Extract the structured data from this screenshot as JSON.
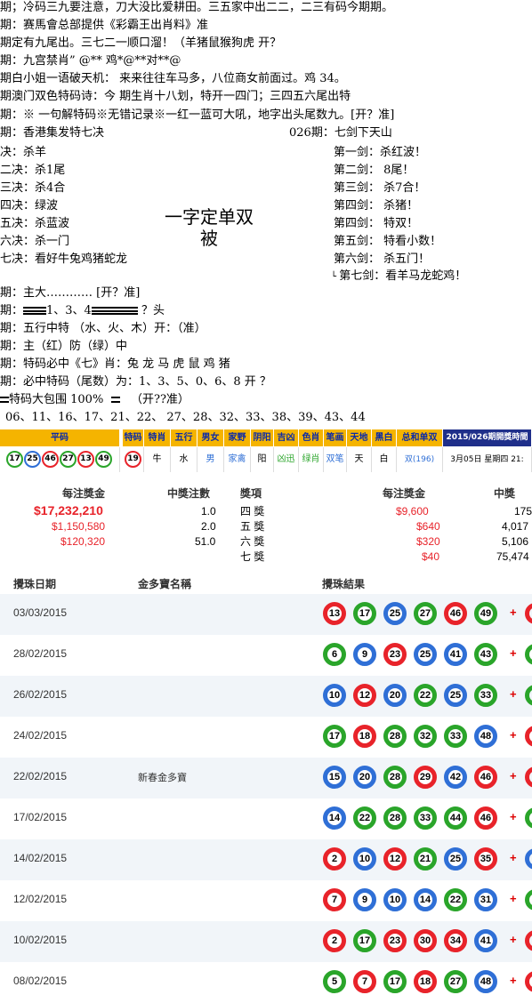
{
  "lines": [
    "期；冷码三九要注意，刀大没比爱耕田。三五家中出二二，二三有码今期期。",
    "期：赛馬會总部提供《彩霸王出肖料》准",
    "期定有九尾出。三七二一顺口溜！（羊猪鼠猴狗虎    开？",
    "期：九宫禁肖”  @** 鸡*@**对**@",
    "期白小姐一语破天机：  来来往往车马多，八位商女前面过。鸡  34。",
    "期澳门双色特码诗：今 期生肖十八划，特开一四门；三四五六尾出特",
    "期：※ 一句解特码※无错记录※一红一蓝可大吼，地字出头尾数九。[开？准]",
    "期：香港集发特七决"
  ],
  "jue_left": [
    "决：杀羊",
    "二决：杀1尾",
    "三决：杀4合",
    "四决：绿波",
    "五决：杀蓝波",
    "六决：杀一门",
    "七决：看好牛兔鸡猪蛇龙"
  ],
  "jue_right_title": "026期：七剑下天山",
  "jue_right": [
    "第一剑：杀红波！",
    "第二剑：  8尾！",
    "第三剑：  杀7合！",
    "第四剑：  杀猪！",
    "第四剑：  特双！",
    "第五剑：  特看小数！",
    "第六剑：  杀五门！",
    "第七剑：看羊马龙蛇鸡！"
  ],
  "big_title_1": "一字定单双",
  "big_title_2": "被",
  "lines2": {
    "zhuda": "期：主大………… [开？准]",
    "tou_mid": "1、3、4",
    "tou_end": "？头",
    "tou_pre": "期：",
    "wuxing": "期：五行中特  （水、火、木）开：（准）",
    "zhufang": "期：主（红）防（绿）中",
    "texiao": "期：特码必中《七》肖：兔 龙 马 虎 鼠 鸡   猪",
    "weishu": "期：必中特码（尾数）为：1、3、5、0、6、8        开 ？",
    "baotou": "特码大包围 100%",
    "baotou_end": "（开??准）",
    "numbers": "06、11、16、17、21、22、 27、28、32、33、38、39、43、44"
  },
  "draw_table": {
    "headers": [
      "平码",
      "特码",
      "特肖",
      "五行",
      "男女",
      "家野",
      "阴阳",
      "吉凶",
      "色肖",
      "笔画",
      "天地",
      "黑白",
      "总和单双",
      "2015/026期開獎時間"
    ],
    "balls": [
      "17",
      "25",
      "46",
      "27",
      "13",
      "49"
    ],
    "special": "19",
    "values": [
      "牛",
      "水",
      "男",
      "家禽",
      "阳",
      "凶迅",
      "绿肖",
      "双笔",
      "天",
      "白",
      "双(196)",
      "3月05日 星期四 21:"
    ]
  },
  "prize": {
    "left_headers": [
      "每注獎金",
      "中獎注數"
    ],
    "left_rows": [
      [
        "$17,232,210",
        "1.0"
      ],
      [
        "$1,150,580",
        "2.0"
      ],
      [
        "$120,320",
        "51.0"
      ]
    ],
    "right_headers": [
      "獎項",
      "每注獎金",
      "中獎"
    ],
    "right_rows": [
      [
        "四 獎",
        "$9,600",
        "175"
      ],
      [
        "五 獎",
        "$640",
        "4,017"
      ],
      [
        "六 獎",
        "$320",
        "5,106"
      ],
      [
        "七 獎",
        "$40",
        "75,474"
      ]
    ]
  },
  "results": {
    "headers": [
      "攪珠日期",
      "金多寶名稱",
      "攪珠結果"
    ],
    "plus": "+",
    "rows": [
      {
        "date": "03/03/2015",
        "name": "",
        "balls": [
          "13",
          "17",
          "25",
          "27",
          "46",
          "49"
        ]
      },
      {
        "date": "28/02/2015",
        "name": "",
        "balls": [
          "6",
          "9",
          "23",
          "25",
          "41",
          "43"
        ]
      },
      {
        "date": "26/02/2015",
        "name": "",
        "balls": [
          "10",
          "12",
          "20",
          "22",
          "25",
          "33"
        ]
      },
      {
        "date": "24/02/2015",
        "name": "",
        "balls": [
          "17",
          "18",
          "28",
          "32",
          "33",
          "48"
        ]
      },
      {
        "date": "22/02/2015",
        "name": "新春金多寶",
        "balls": [
          "15",
          "20",
          "28",
          "29",
          "42",
          "46"
        ]
      },
      {
        "date": "17/02/2015",
        "name": "",
        "balls": [
          "14",
          "22",
          "28",
          "33",
          "44",
          "46"
        ]
      },
      {
        "date": "14/02/2015",
        "name": "",
        "balls": [
          "2",
          "10",
          "12",
          "21",
          "25",
          "35"
        ]
      },
      {
        "date": "12/02/2015",
        "name": "",
        "balls": [
          "7",
          "9",
          "10",
          "14",
          "22",
          "31"
        ]
      },
      {
        "date": "10/02/2015",
        "name": "",
        "balls": [
          "2",
          "17",
          "23",
          "30",
          "34",
          "41"
        ]
      },
      {
        "date": "08/02/2015",
        "name": "",
        "balls": [
          "5",
          "7",
          "17",
          "18",
          "27",
          "48"
        ]
      }
    ]
  },
  "colors": {
    "red": "#e8232a",
    "blue": "#2f6fd6",
    "green": "#2aa52a",
    "gold": "#f5b400",
    "navy": "#1f2f8a"
  }
}
